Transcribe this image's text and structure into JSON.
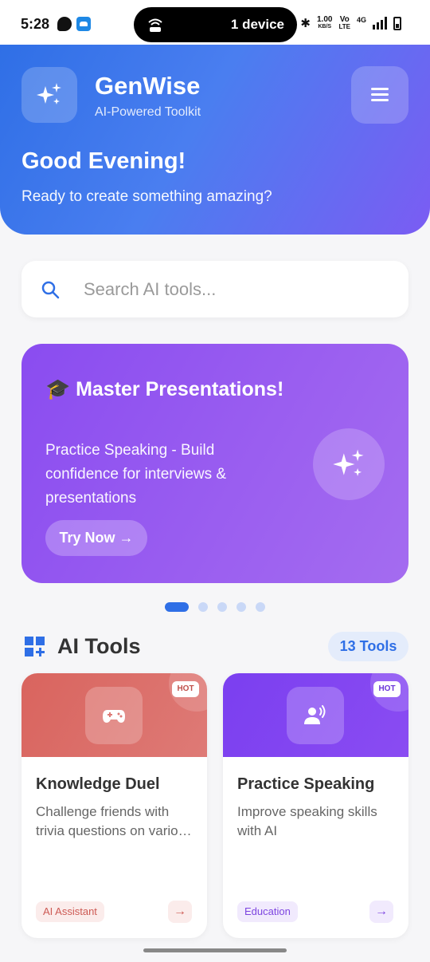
{
  "status_bar": {
    "time": "5:28",
    "pill_text": "1 device",
    "net_speed_value": "1.00",
    "net_speed_unit": "KB/S",
    "volte_top": "Vo",
    "volte_bottom": "LTE",
    "network": "4G"
  },
  "header": {
    "app_title": "GenWise",
    "app_subtitle": "AI-Powered Toolkit",
    "greeting": "Good Evening!",
    "subgreeting": "Ready to create something amazing?"
  },
  "search": {
    "placeholder": "Search AI tools..."
  },
  "banner": {
    "title": "🎓 Master Presentations!",
    "description": "Practice Speaking - Build confidence for interviews & presentations",
    "button_label": "Try Now →",
    "active_slide_index": 0,
    "slide_count": 5
  },
  "tools_section": {
    "title": "AI Tools",
    "count_label": "13 Tools"
  },
  "tool_cards": [
    {
      "badge": "HOT",
      "title": "Knowledge Duel",
      "description": "Challenge friends with trivia questions on various topics",
      "tag": "AI Assistant",
      "icon": "gamepad-icon",
      "color": "#d9645e",
      "arrow": "→"
    },
    {
      "badge": "HOT",
      "title": "Practice Speaking",
      "description": "Improve speaking skills with AI",
      "tag": "Education",
      "icon": "speaking-person-icon",
      "color": "#7b3ff0",
      "arrow": "→"
    }
  ],
  "colors": {
    "primary_blue": "#2f6fe6",
    "header_purple": "#7b5cf3",
    "banner_purple": "#8a4cf0"
  }
}
